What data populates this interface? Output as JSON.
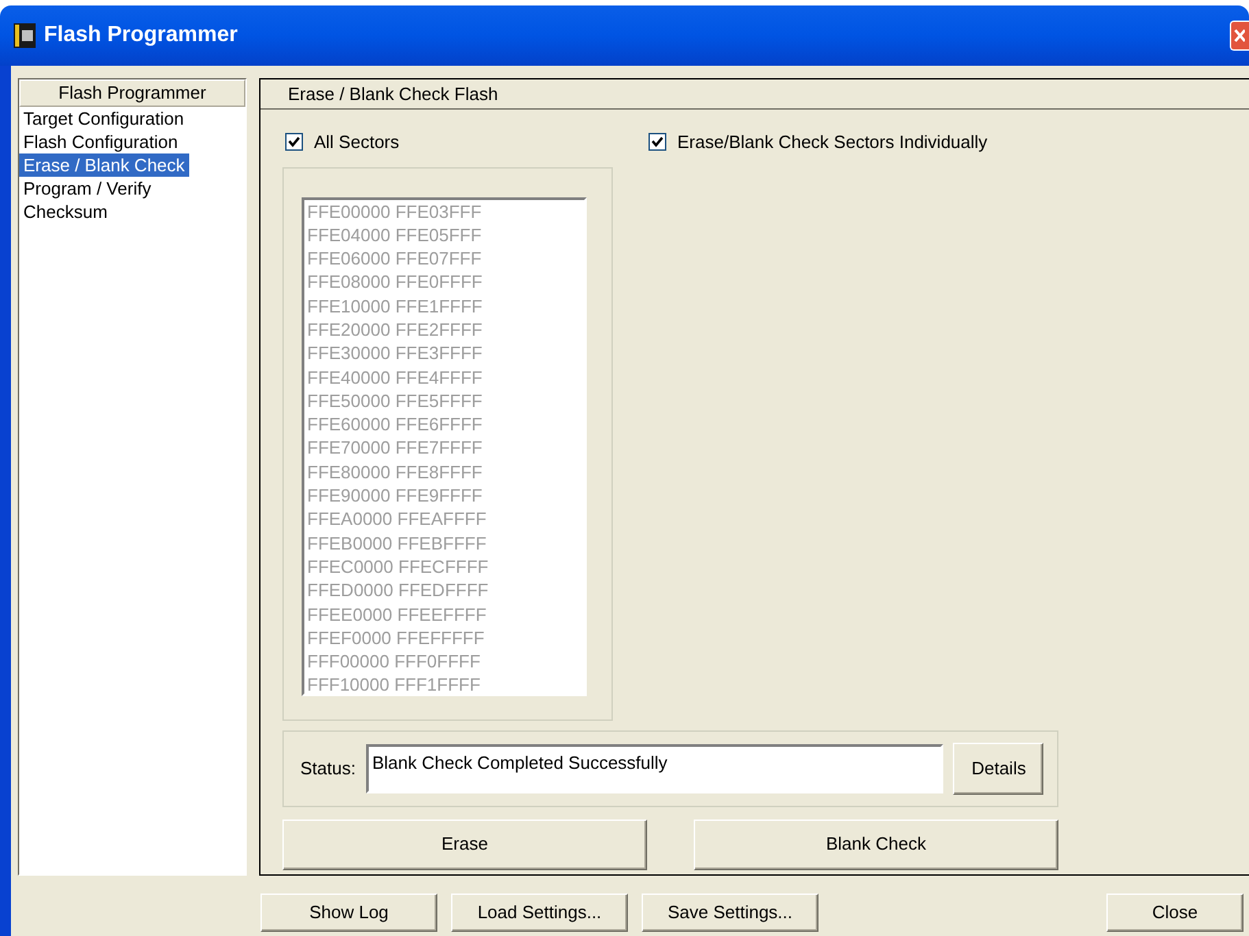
{
  "window": {
    "title": "Flash Programmer"
  },
  "sidebar": {
    "header": "Flash Programmer",
    "items": [
      {
        "label": "Target Configuration",
        "selected": false
      },
      {
        "label": "Flash Configuration",
        "selected": false
      },
      {
        "label": "Erase / Blank Check",
        "selected": true
      },
      {
        "label": "Program / Verify",
        "selected": false
      },
      {
        "label": "Checksum",
        "selected": false
      }
    ]
  },
  "panel": {
    "title": "Erase / Blank Check Flash",
    "options": [
      {
        "label": "All Sectors",
        "checked": true
      },
      {
        "label": "Erase/Blank Check Sectors Individually",
        "checked": true
      }
    ],
    "sectors": {
      "disabled": true,
      "rows": [
        {
          "start": "FFE00000",
          "end": "FFE03FFF"
        },
        {
          "start": "FFE04000",
          "end": "FFE05FFF"
        },
        {
          "start": "FFE06000",
          "end": "FFE07FFF"
        },
        {
          "start": "FFE08000",
          "end": "FFE0FFFF"
        },
        {
          "start": "FFE10000",
          "end": "FFE1FFFF"
        },
        {
          "start": "FFE20000",
          "end": "FFE2FFFF"
        },
        {
          "start": "FFE30000",
          "end": "FFE3FFFF"
        },
        {
          "start": "FFE40000",
          "end": "FFE4FFFF"
        },
        {
          "start": "FFE50000",
          "end": "FFE5FFFF"
        },
        {
          "start": "FFE60000",
          "end": "FFE6FFFF"
        },
        {
          "start": "FFE70000",
          "end": "FFE7FFFF"
        },
        {
          "start": "FFE80000",
          "end": "FFE8FFFF"
        },
        {
          "start": "FFE90000",
          "end": "FFE9FFFF"
        },
        {
          "start": "FFEA0000",
          "end": "FFEAFFFF"
        },
        {
          "start": "FFEB0000",
          "end": "FFEBFFFF"
        },
        {
          "start": "FFEC0000",
          "end": "FFECFFFF"
        },
        {
          "start": "FFED0000",
          "end": "FFEDFFFF"
        },
        {
          "start": "FFEE0000",
          "end": "FFEEFFFF"
        },
        {
          "start": "FFEF0000",
          "end": "FFEFFFFF"
        },
        {
          "start": "FFF00000",
          "end": "FFF0FFFF"
        },
        {
          "start": "FFF10000",
          "end": "FFF1FFFF"
        }
      ]
    },
    "status": {
      "label": "Status:",
      "value": "Blank Check Completed Successfully",
      "button": "Details"
    },
    "actions": [
      "Erase",
      "Blank Check"
    ]
  },
  "footer": {
    "left_buttons": [
      "Show Log",
      "Load Settings...",
      "Save Settings..."
    ],
    "close": "Close"
  }
}
